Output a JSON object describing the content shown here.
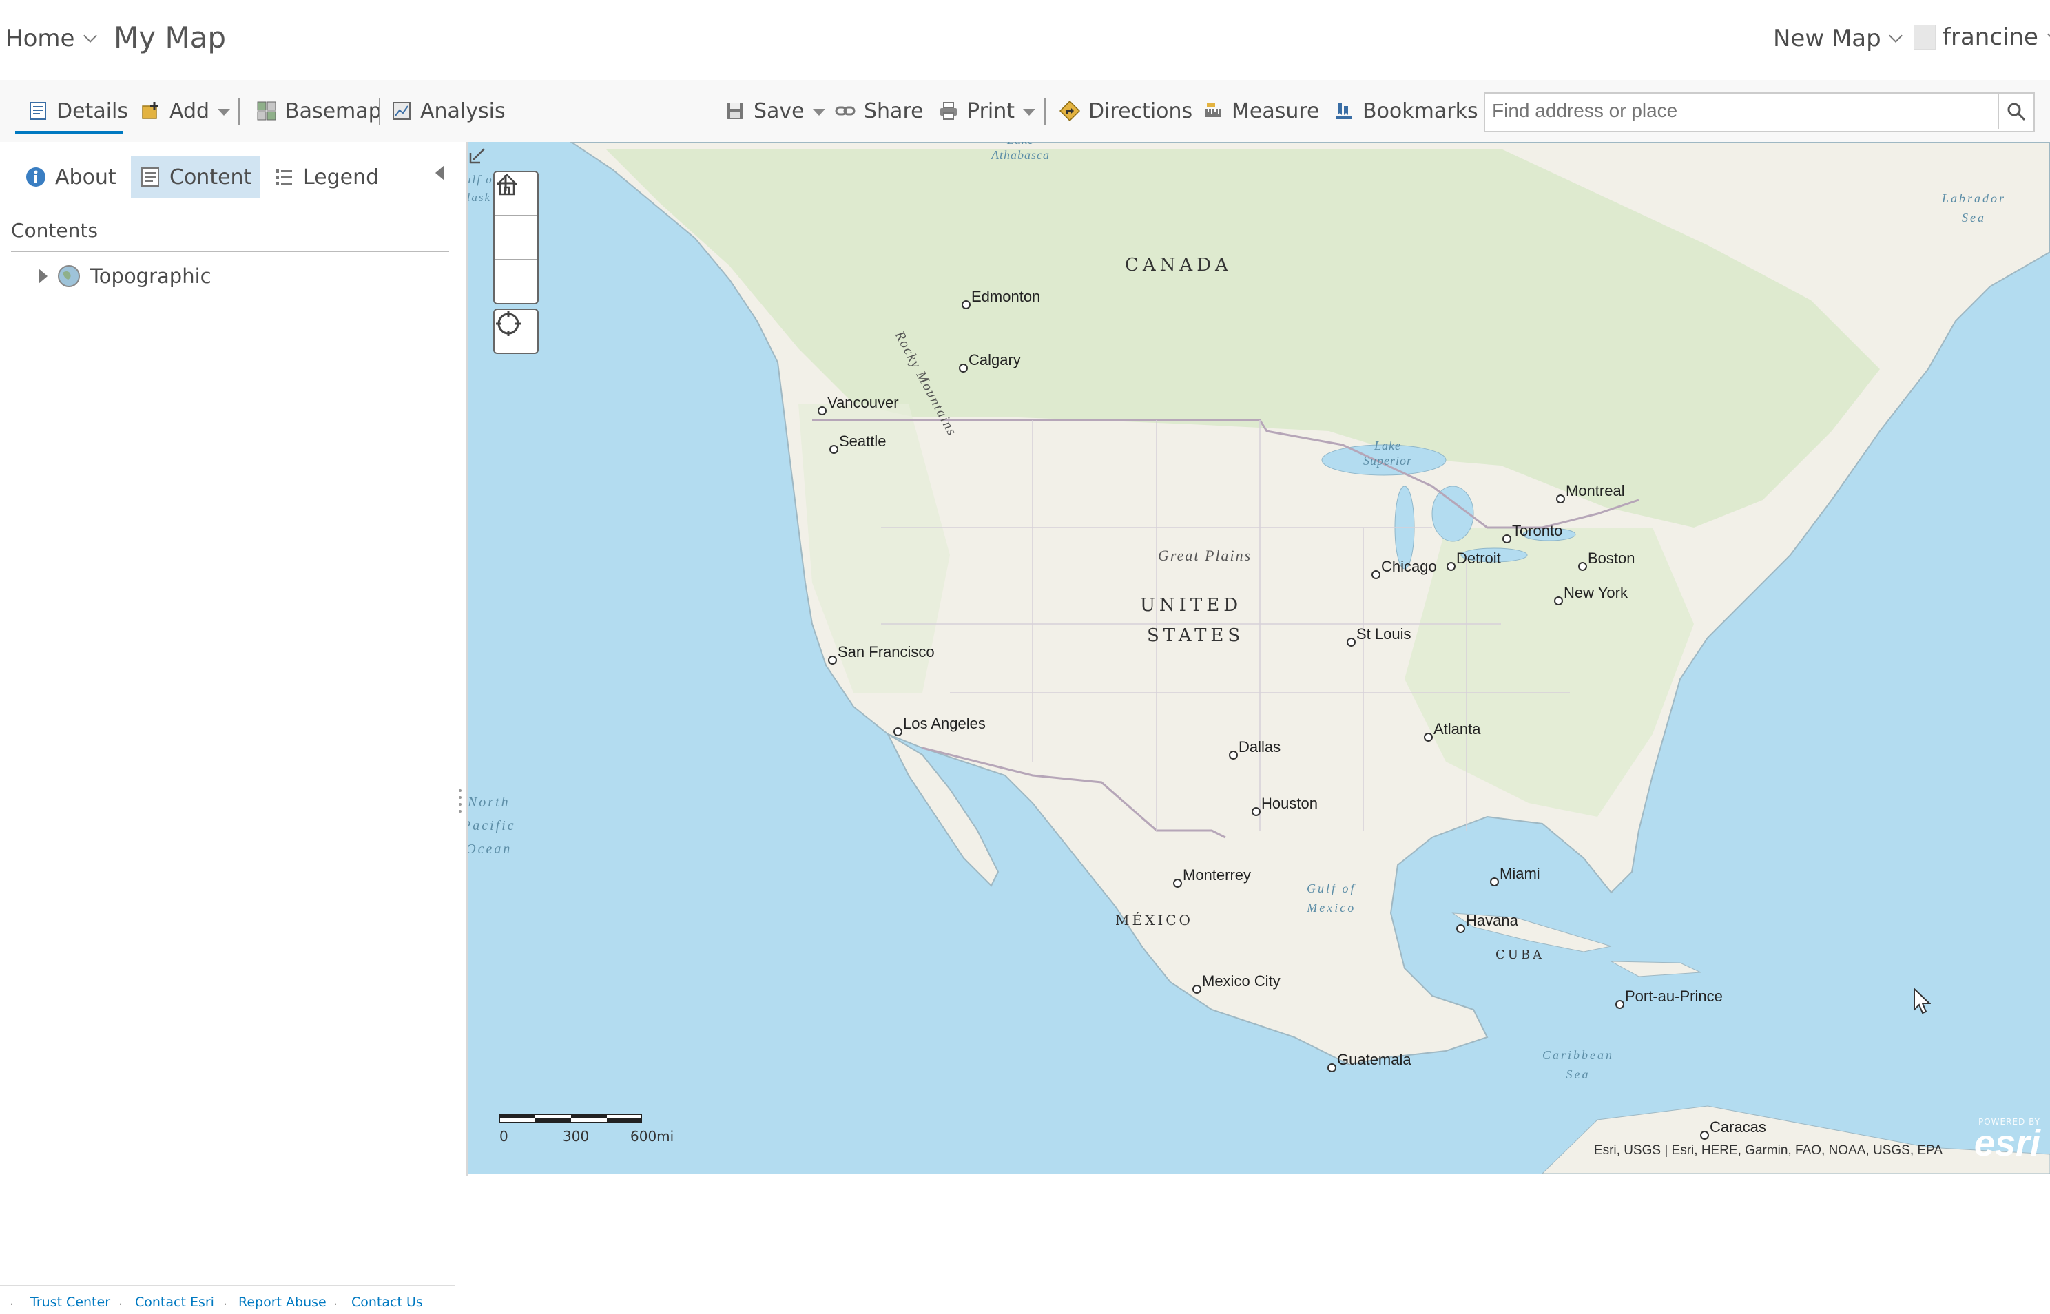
{
  "header": {
    "home_label": "Home",
    "map_title": "My Map",
    "new_map_label": "New Map",
    "user_name": "francine"
  },
  "toolbar": {
    "details": "Details",
    "add": "Add",
    "basemap": "Basemap",
    "analysis": "Analysis",
    "save": "Save",
    "share": "Share",
    "print": "Print",
    "directions": "Directions",
    "measure": "Measure",
    "bookmarks": "Bookmarks",
    "search_placeholder": "Find address or place"
  },
  "sidebar": {
    "tabs": [
      {
        "label": "About",
        "icon": "info-icon",
        "active": false
      },
      {
        "label": "Content",
        "icon": "content-icon",
        "active": true
      },
      {
        "label": "Legend",
        "icon": "legend-icon",
        "active": false
      }
    ],
    "contents_heading": "Contents",
    "layers": [
      {
        "name": "Topographic",
        "icon": "globe-icon"
      }
    ],
    "footer_links": [
      "Trust Center",
      "Contact Esri",
      "Report Abuse",
      "Contact Us"
    ]
  },
  "map": {
    "countries": [
      "CANADA",
      "UNITED",
      "STATES",
      "MÉXICO",
      "CUBA"
    ],
    "cities": [
      "Edmonton",
      "Calgary",
      "Vancouver",
      "Seattle",
      "San Francisco",
      "Los Angeles",
      "Dallas",
      "Houston",
      "Monterrey",
      "Mexico City",
      "Guatemala",
      "Chicago",
      "Detroit",
      "Toronto",
      "Montreal",
      "Boston",
      "New York",
      "St Louis",
      "Atlanta",
      "Miami",
      "Havana",
      "Port-au-Prince",
      "Caracas"
    ],
    "water_labels": {
      "lake_athabasca": "Lake\nAthabasca",
      "lake_superior": "Lake\nSuperior",
      "labrador_sea": "Labrador\nSea",
      "north_pacific": "North\nPacific\nOcean",
      "gulf_of_mexico": "Gulf of\nMexico",
      "caribbean_sea": "Caribbean\nSea",
      "gulf_partial": "ulf o\nlask"
    },
    "regions": {
      "great_plains": "Great Plains",
      "rocky_mountains": "Rocky Mountains"
    },
    "scale": {
      "labels": [
        "0",
        "300",
        "600mi"
      ]
    },
    "attribution": "Esri, USGS | Esri, HERE, Garmin, FAO, NOAA, USGS, EPA",
    "logo_powered": "POWERED BY",
    "logo_text": "esri"
  },
  "colors": {
    "accent": "#0079c1",
    "active_tab_bg": "#d1e4f2",
    "water": "#b3dcf0",
    "land": "#f3f1ea",
    "forest": "#d9e8c8"
  }
}
